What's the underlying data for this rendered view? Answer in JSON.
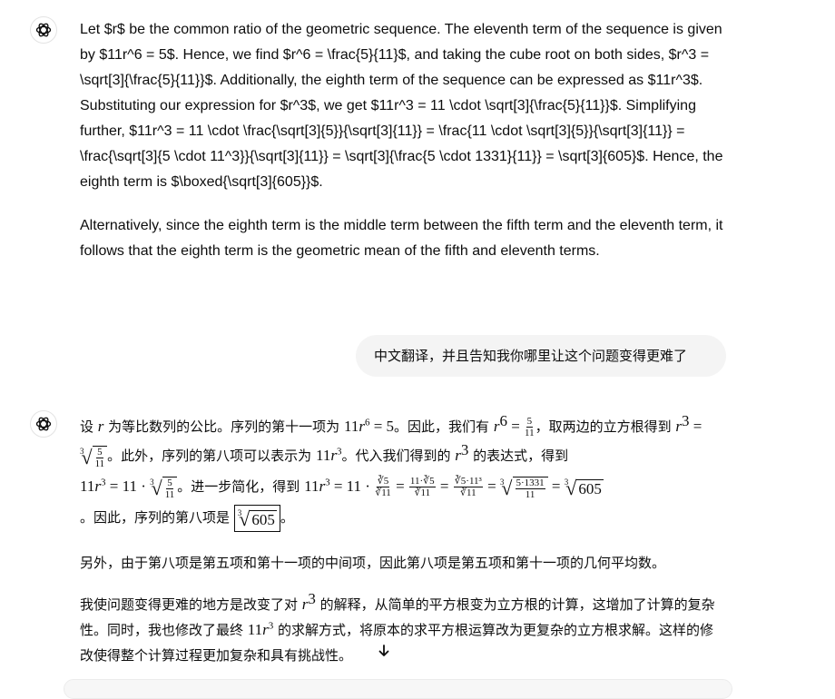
{
  "assistant_msg_1": {
    "paragraph_1": "Let $r$ be the common ratio of the geometric sequence. The eleventh term of the sequence is given by $11r^6 = 5$. Hence, we find $r^6 = \\frac{5}{11}$, and taking the cube root on both sides, $r^3 = \\sqrt[3]{\\frac{5}{11}}$. Additionally, the eighth term of the sequence can be expressed as $11r^3$. Substituting our expression for $r^3$, we get $11r^3 = 11 \\cdot \\sqrt[3]{\\frac{5}{11}}$. Simplifying further, $11r^3 = 11 \\cdot \\frac{\\sqrt[3]{5}}{\\sqrt[3]{11}} = \\frac{11 \\cdot \\sqrt[3]{5}}{\\sqrt[3]{11}} = \\frac{\\sqrt[3]{5 \\cdot 11^3}}{\\sqrt[3]{11}} = \\sqrt[3]{\\frac{5 \\cdot 1331}{11}} = \\sqrt[3]{605}$. Hence, the eighth term is $\\boxed{\\sqrt[3]{605}}$.",
    "paragraph_2": "Alternatively, since the eighth term is the middle term between the fifth term and the eleventh term, it follows that the eighth term is the geometric mean of the fifth and eleventh terms."
  },
  "user_msg": {
    "text": "中文翻译，并且告知我你哪里让这个问题变得更难了"
  },
  "assistant_msg_2": {
    "p1_a": "设 ",
    "p1_b": " 为等比数列的公比。序列的第十一项为 ",
    "p1_c": "。因此，我们有 ",
    "p1_d": "，取两边的立方根得到 ",
    "p1_e": "。此外，序列的第八项可以表示为 ",
    "p1_f": "。代入我们得到的 ",
    "p1_g": " 的表达式，得到 ",
    "p1_h": "。进一步简化，得到 ",
    "p1_i": "。因此，序列的第八项是 ",
    "p1_j": "。",
    "paragraph_2": "另外，由于第八项是第五项和第十一项的中间项，因此第八项是第五项和第十一项的几何平均数。",
    "p3_a": "我使问题变得更难的地方是改变了对 ",
    "p3_b": " 的解释，从简单的平方根变为立方根的计算，这增加了计算的复杂性。同时，我也修改了最终 ",
    "p3_c": " 的求解方式，将原本的求平方根运算改为更复杂的立方根求解。这样的修改使得整个计算过程更加复杂和具有挑战性。"
  },
  "icons": {
    "assistant_avatar": "openai-logo-icon",
    "scroll_down": "arrow-down-icon"
  }
}
